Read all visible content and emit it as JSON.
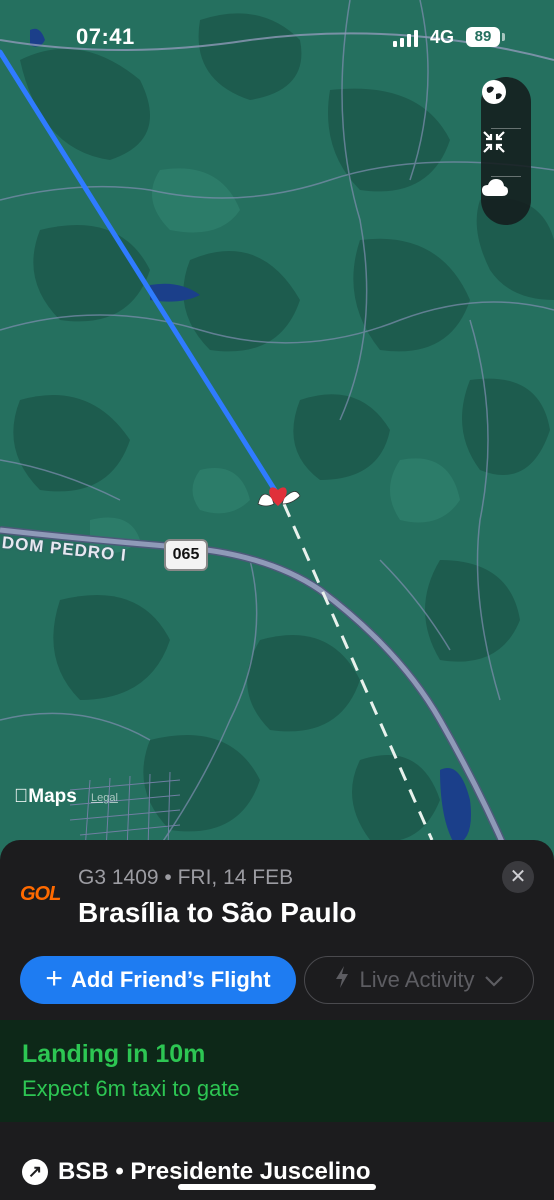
{
  "status_bar": {
    "time": "07:41",
    "network": "4G",
    "battery": "89"
  },
  "map": {
    "road_name": "DOM PEDRO I",
    "road_shield": "065",
    "attribution": "Maps",
    "legal": "Legal",
    "colors": {
      "land": "#25705f",
      "forest": "#1e5e4f",
      "road": "#8f9ab8",
      "flown_path": "#2f7bff",
      "planned_path": "#e8f1ec"
    }
  },
  "map_controls": {
    "icons": [
      "globe-icon",
      "collapse-icon",
      "cloud-icon"
    ]
  },
  "flight_card": {
    "airline_logo": "GOL",
    "flight_meta": "G3 1409 • FRI, 14 FEB",
    "route": "Brasília to São Paulo",
    "add_friend_label": "Add Friend’s Flight",
    "live_activity_label": "Live Activity",
    "status": {
      "headline": "Landing in 10m",
      "detail": "Expect 6m taxi to gate"
    },
    "departure": {
      "line": "BSB • Presidente Juscelino"
    },
    "colors": {
      "accent": "#1e7cf2",
      "status_green": "#2dc653",
      "logo_orange": "#ff6a00"
    }
  }
}
